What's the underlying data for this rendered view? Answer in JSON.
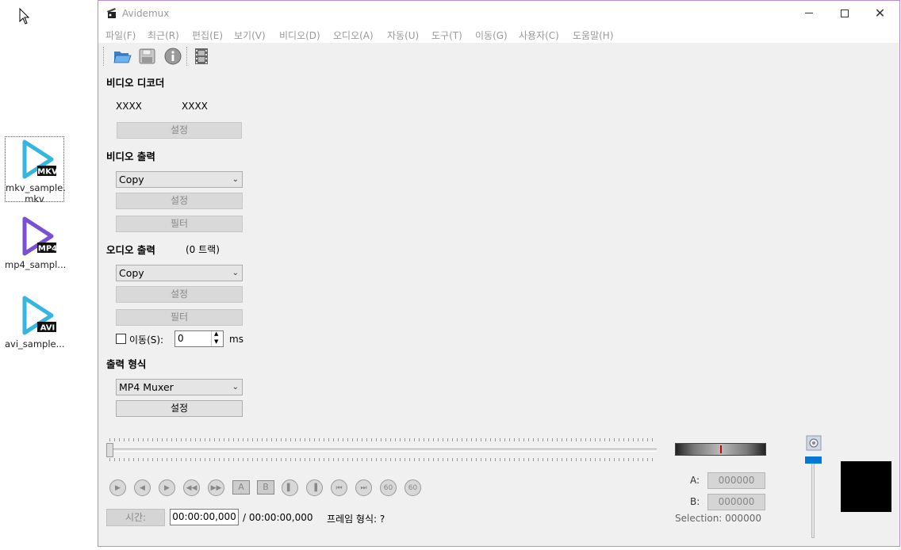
{
  "desktop": {
    "icons": [
      {
        "badge": "MKV",
        "label": "mkv_sample.\nmkv",
        "color": "#35b6e0"
      },
      {
        "badge": "MP4",
        "label": "mp4_sampl...",
        "color": "#7a4fd6"
      },
      {
        "badge": "AVI",
        "label": "avi_sample...",
        "color": "#35b6e0"
      }
    ]
  },
  "window": {
    "title": "Avidemux",
    "menu": [
      "파일(F)",
      "최근(R)",
      "편집(E)",
      "보기(V)",
      "비디오(D)",
      "오디오(A)",
      "자동(U)",
      "도구(T)",
      "이동(G)",
      "사용자(C)",
      "도움말(H)"
    ]
  },
  "toolbar": {
    "icons": [
      "open-folder-icon",
      "save-icon",
      "info-icon",
      "film-icon"
    ]
  },
  "video_decoder": {
    "heading": "비디오 디코더",
    "codec1": "XXXX",
    "codec2": "XXXX",
    "config_label": "설정"
  },
  "video_output": {
    "heading": "비디오 출력",
    "selected": "Copy",
    "config_label": "설정",
    "filter_label": "필터"
  },
  "audio_output": {
    "heading": "오디오 출력",
    "tracks": "(0 트랙)",
    "selected": "Copy",
    "config_label": "설정",
    "filter_label": "필터",
    "shift_label": "이동(S):",
    "shift_value": "0",
    "shift_unit": "ms"
  },
  "output_format": {
    "heading": "출력 형식",
    "selected": "MP4 Muxer",
    "config_label": "설정"
  },
  "timeline": {
    "time_button": "시간:",
    "current_time": "00:00:00,000",
    "total_time": "/ 00:00:00,000",
    "frame_type": "프레임 형식: ?"
  },
  "selection": {
    "a_label": "A:",
    "a_value": "000000",
    "b_label": "B:",
    "b_value": "000000",
    "selection_text": "Selection: 000000"
  },
  "colors": {
    "accent": "#0078d7",
    "marker": "#cc0000"
  }
}
